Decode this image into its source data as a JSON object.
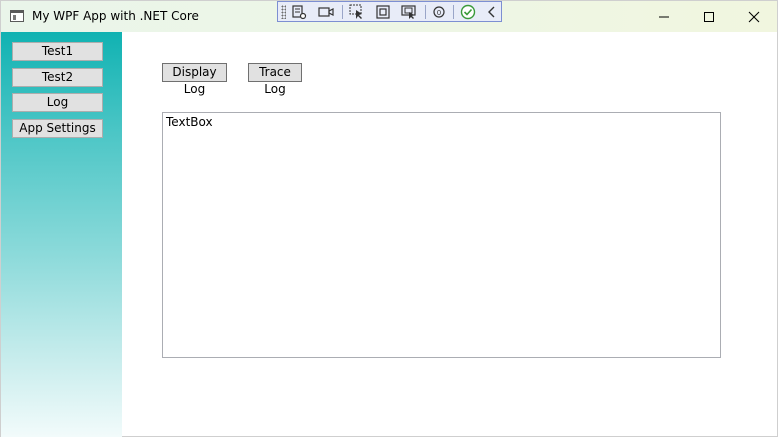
{
  "window": {
    "title": "My WPF App with .NET Core",
    "controls": [
      "minimize",
      "maximize",
      "close"
    ]
  },
  "debug_toolbar": {
    "icons": [
      "visual-tree-icon",
      "record-icon",
      "select-element-icon",
      "display-adorners-icon",
      "track-focus-icon",
      "binding-failures-icon",
      "hot-reload-ok-icon",
      "collapse-icon"
    ]
  },
  "sidebar": {
    "buttons": [
      {
        "label": "Test1"
      },
      {
        "label": "Test2"
      },
      {
        "label": "Log"
      },
      {
        "label": "App Settings"
      }
    ]
  },
  "main": {
    "display_log_label": "Display Log",
    "trace_log_label": "Trace Log",
    "textbox_text": "TextBox"
  },
  "colors": {
    "sidebar_top": "#10b2b2",
    "sidebar_bottom": "#f2fbfb",
    "button_face": "#e1e1e1",
    "debug_toolbar_border": "#7d8fd2"
  }
}
